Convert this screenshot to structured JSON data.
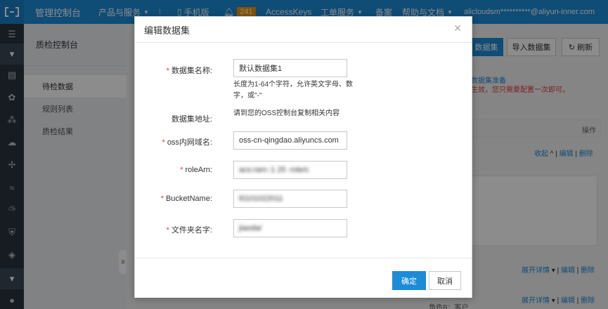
{
  "topbar": {
    "title": "管理控制台",
    "products": "产品与服务",
    "mobile": "手机版",
    "badge": "241",
    "accesskeys": "AccessKeys",
    "tickets": "工单服务",
    "beian": "备案",
    "help": "帮助与文档",
    "user": "alicloudsm**********@aliyun-inner.com"
  },
  "sidebar": {
    "title": "质检控制台",
    "items": [
      {
        "label": "待检数据"
      },
      {
        "label": "规则列表"
      },
      {
        "label": "质检结果"
      }
    ]
  },
  "main": {
    "btn_new": "数据集",
    "btn_import": "导入数据集",
    "btn_refresh": "刷新",
    "notice_line1": "数据集准备",
    "notice_line2": "生效，您只需要配置一次即可。",
    "col_ops": "操作",
    "row1_actions": {
      "collapse": "收起",
      "edit": "编辑",
      "delete": "删除"
    },
    "row2_actions": {
      "expand": "展开详情",
      "edit": "编辑",
      "delete": "删除"
    },
    "row3_actions": {
      "expand": "展开详情",
      "edit": "编辑",
      "delete": "删除"
    },
    "row3_role": "角色B：客户"
  },
  "modal": {
    "title": "编辑数据集",
    "fields": {
      "name_label": "数据集名称:",
      "name_value": "默认数据集1",
      "name_help": "长度为1-64个字符，允许英文字母、数字，或\"-\"",
      "addr_label": "数据集地址:",
      "addr_text": "请到您的OSS控制台复制相关内容",
      "oss_label": "oss内网域名:",
      "oss_value": "oss-cn-qingdao.aliyuncs.com",
      "role_label": "roleArn:",
      "role_value": "acs:ram::1   25        :role/c",
      "bucket_label": "BucketName:",
      "bucket_value": "l0101022011",
      "folder_label": "文件夹名字:",
      "folder_value": "jiaoda/"
    },
    "ok": "确定",
    "cancel": "取消"
  }
}
